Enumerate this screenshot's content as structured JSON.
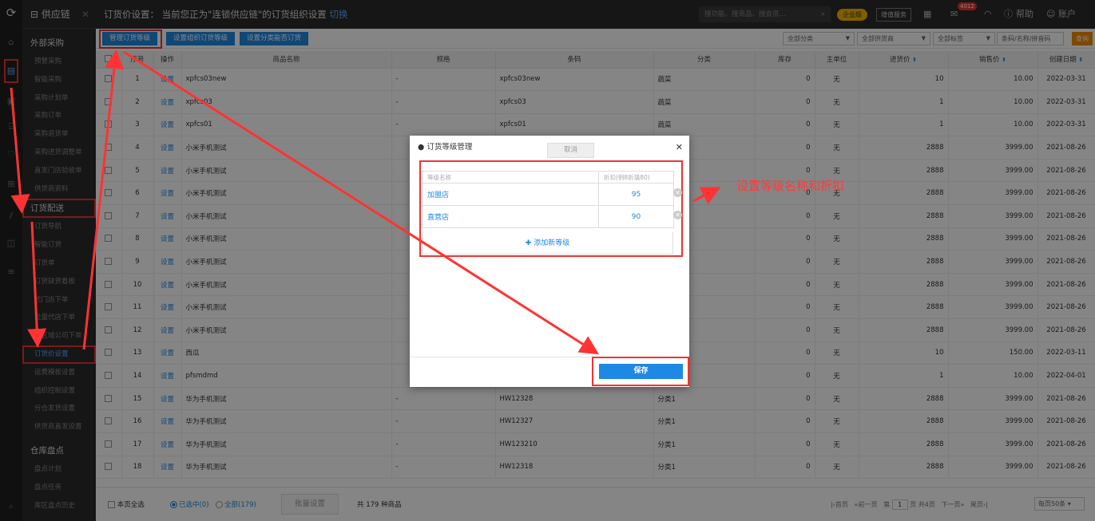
{
  "sidebar": {
    "module_title": "供应链",
    "groups": [
      {
        "label": "外部采购",
        "items": [
          "预警采购",
          "智能采购",
          "采购计划单",
          "采购订单",
          "采购退货单",
          "采购进货调整单",
          "直发门店验收单",
          "供货商资料"
        ]
      },
      {
        "label": "订货配送",
        "items": [
          "订货导航",
          "智能订货",
          "订货单",
          "订货缺货看板",
          "代门店下单",
          "批量代店下单",
          "跨区域公司下单",
          "订货价设置",
          "运费模板设置",
          "组织控制设置",
          "分仓发货设置",
          "供货商直发设置"
        ]
      },
      {
        "label": "仓库盘点",
        "items": [
          "盘点计划",
          "盘点任务",
          "库区盘点历史"
        ]
      }
    ]
  },
  "header": {
    "title_prefix": "订货价设置：",
    "title": "当前您正为\"连锁供应链\"的订货组织设置",
    "switch_link": "切换",
    "search_placeholder": "搜功能、搜商品、搜会员...",
    "enterprise_badge": "企业版",
    "value_added": "增值服务",
    "notif_count": "4012",
    "help": "帮助",
    "account": "账户"
  },
  "toolbar": {
    "manage_levels": "管理订货等级",
    "set_org_level": "设置组织订货等级",
    "set_category": "设置分类能否订货",
    "filter_category": "全部分类",
    "filter_supplier": "全部供货商",
    "filter_tag": "全部标签",
    "barcode_placeholder": "条码/名称/拼音码",
    "query": "查询"
  },
  "table": {
    "columns": [
      "序号",
      "操作",
      "商品名称",
      "规格",
      "条码",
      "分类",
      "库存",
      "主单位",
      "进货价",
      "销售价",
      "创建日期"
    ],
    "sortable_columns": [
      "进货价",
      "销售价",
      "创建日期"
    ],
    "action_label": "设置",
    "rows": [
      {
        "no": "1",
        "name": "xpfcs03new",
        "spec": "-",
        "barcode": "xpfcs03new",
        "category": "蔬菜",
        "stock": "0",
        "unit": "无",
        "cost": "10",
        "price": "10.00",
        "date": "2022-03-31"
      },
      {
        "no": "2",
        "name": "xpfcs03",
        "spec": "-",
        "barcode": "xpfcs03",
        "category": "蔬菜",
        "stock": "0",
        "unit": "无",
        "cost": "1",
        "price": "10.00",
        "date": "2022-03-31"
      },
      {
        "no": "3",
        "name": "xpfcs01",
        "spec": "-",
        "barcode": "xpfcs01",
        "category": "蔬菜",
        "stock": "0",
        "unit": "无",
        "cost": "1",
        "price": "10.00",
        "date": "2022-03-31"
      },
      {
        "no": "4",
        "name": "小米手机测试",
        "spec": "",
        "barcode": "",
        "category": "",
        "stock": "0",
        "unit": "无",
        "cost": "2888",
        "price": "3999.00",
        "date": "2021-08-26"
      },
      {
        "no": "5",
        "name": "小米手机测试",
        "spec": "",
        "barcode": "",
        "category": "",
        "stock": "0",
        "unit": "无",
        "cost": "2888",
        "price": "3999.00",
        "date": "2021-08-26"
      },
      {
        "no": "6",
        "name": "小米手机测试",
        "spec": "",
        "barcode": "",
        "category": "",
        "stock": "0",
        "unit": "无",
        "cost": "2888",
        "price": "3999.00",
        "date": "2021-08-26"
      },
      {
        "no": "7",
        "name": "小米手机测试",
        "spec": "",
        "barcode": "",
        "category": "",
        "stock": "0",
        "unit": "无",
        "cost": "2888",
        "price": "3999.00",
        "date": "2021-08-26"
      },
      {
        "no": "8",
        "name": "小米手机测试",
        "spec": "",
        "barcode": "",
        "category": "",
        "stock": "0",
        "unit": "无",
        "cost": "2888",
        "price": "3999.00",
        "date": "2021-08-26"
      },
      {
        "no": "9",
        "name": "小米手机测试",
        "spec": "",
        "barcode": "",
        "category": "",
        "stock": "0",
        "unit": "无",
        "cost": "2888",
        "price": "3999.00",
        "date": "2021-08-26"
      },
      {
        "no": "10",
        "name": "小米手机测试",
        "spec": "",
        "barcode": "",
        "category": "",
        "stock": "0",
        "unit": "无",
        "cost": "2888",
        "price": "3999.00",
        "date": "2021-08-26"
      },
      {
        "no": "11",
        "name": "小米手机测试",
        "spec": "",
        "barcode": "",
        "category": "",
        "stock": "0",
        "unit": "无",
        "cost": "2888",
        "price": "3999.00",
        "date": "2021-08-26"
      },
      {
        "no": "12",
        "name": "小米手机测试",
        "spec": "",
        "barcode": "",
        "category": "",
        "stock": "0",
        "unit": "无",
        "cost": "2888",
        "price": "3999.00",
        "date": "2021-08-26"
      },
      {
        "no": "13",
        "name": "西瓜",
        "spec": "",
        "barcode": "",
        "category": "",
        "stock": "0",
        "unit": "无",
        "cost": "10",
        "price": "150.00",
        "date": "2022-03-11"
      },
      {
        "no": "14",
        "name": "pfsmdmd",
        "spec": "",
        "barcode": "",
        "category": "",
        "stock": "0",
        "unit": "无",
        "cost": "1",
        "price": "10.00",
        "date": "2022-04-01"
      },
      {
        "no": "15",
        "name": "华为手机测试",
        "spec": "-",
        "barcode": "HW12328",
        "category": "分类1",
        "stock": "0",
        "unit": "无",
        "cost": "2888",
        "price": "3999.00",
        "date": "2021-08-26"
      },
      {
        "no": "16",
        "name": "华为手机测试",
        "spec": "-",
        "barcode": "HW12327",
        "category": "分类1",
        "stock": "0",
        "unit": "无",
        "cost": "2888",
        "price": "3999.00",
        "date": "2021-08-26"
      },
      {
        "no": "17",
        "name": "华为手机测试",
        "spec": "-",
        "barcode": "HW123210",
        "category": "分类1",
        "stock": "0",
        "unit": "无",
        "cost": "2888",
        "price": "3999.00",
        "date": "2021-08-26"
      },
      {
        "no": "18",
        "name": "华为手机测试",
        "spec": "-",
        "barcode": "HW12318",
        "category": "分类1",
        "stock": "0",
        "unit": "无",
        "cost": "2888",
        "price": "3999.00",
        "date": "2021-08-26"
      }
    ]
  },
  "footer": {
    "select_page": "本页全选",
    "selected_label": "已选中(0)",
    "all_label": "全部(179)",
    "batch": "批量设置",
    "total": "共 179 种商品",
    "first": "首页",
    "prev": "前一页",
    "page_prefix": "第",
    "page_value": "1",
    "page_suffix": "页 共4页",
    "next": "下一页",
    "last": "尾页",
    "per_page": "每页50条"
  },
  "modal": {
    "title": "订货等级管理",
    "col_name_placeholder": "等级名称",
    "col_discount_placeholder": "折扣(例8折填80)",
    "levels": [
      {
        "name": "加盟店",
        "discount": "95"
      },
      {
        "name": "直营店",
        "discount": "90"
      }
    ],
    "add_level": "添加新等级",
    "cancel": "取消",
    "save": "保存"
  },
  "annotation": "设置等级名称和折扣",
  "colors": {
    "accent": "#1e88e5",
    "highlight": "#ee3333",
    "query": "#f08a00",
    "badge": "#f5b500"
  }
}
